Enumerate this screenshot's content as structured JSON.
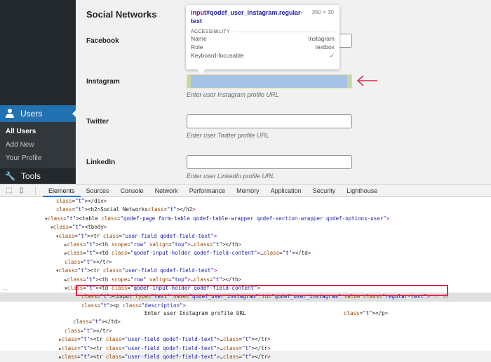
{
  "sidebar": {
    "users_label": "Users",
    "submenu": [
      "All Users",
      "Add New",
      "Your Profile"
    ],
    "tools_label": "Tools"
  },
  "page": {
    "section_title": "Social Networks",
    "fields": [
      {
        "label": "Facebook",
        "value": "",
        "description": ""
      },
      {
        "label": "Instagram",
        "value": "",
        "description": "Enter user Instagram profile URL"
      },
      {
        "label": "Twitter",
        "value": "",
        "description": "Enter user Twitter profile URL"
      },
      {
        "label": "LinkedIn",
        "value": "",
        "description": "Enter user LinkedIn profile URL"
      }
    ]
  },
  "tooltip": {
    "tag": "input",
    "selector": "#qodef_user_instagram.regular-text",
    "dimensions": "350 × 30",
    "section": "ACCESSIBILITY",
    "rows": [
      {
        "key": "Name",
        "value": "Instagram"
      },
      {
        "key": "Role",
        "value": "textbox"
      },
      {
        "key": "Keyboard-focusable",
        "value": "✓"
      }
    ]
  },
  "devtools": {
    "tabs": [
      "Elements",
      "Sources",
      "Console",
      "Network",
      "Performance",
      "Memory",
      "Application",
      "Security",
      "Lighthouse"
    ],
    "active_tab": "Elements",
    "code_lines": [
      "</div>",
      "<h2>Social Networks</h2>",
      "<table class=\"qodef-page form-table qodef-table-wrapper qodef-section-wrapper qodef-options-user\">",
      "<tbody>",
      "<tr class=\"user-field qodef-field-text\">",
      "<th scope=\"row\" valign=\"top\">…</th>",
      "<td class=\"qodef-input-holder qodef-field-content\">…</td>",
      "</tr>",
      "<tr class=\"user-field qodef-field-text\">",
      "<th scope=\"row\" valign=\"top\">…</th>",
      "<td class=\"qodef-input-holder qodef-field-content\">",
      "<input type=\"text\" name=\"qodef_user_instagram\" id=\"qodef_user_instagram\" value class=\"regular-text\"> == $0",
      "<p class=\"description\">",
      "Enter user Instagram profile URL",
      "</p>",
      "</td>",
      "</tr>",
      "<tr class=\"user-field qodef-field-text\">…</tr>",
      "<tr class=\"user-field qodef-field-text\">…</tr>",
      "<tr class=\"user-field qodef-field-text\">…</tr>"
    ]
  }
}
